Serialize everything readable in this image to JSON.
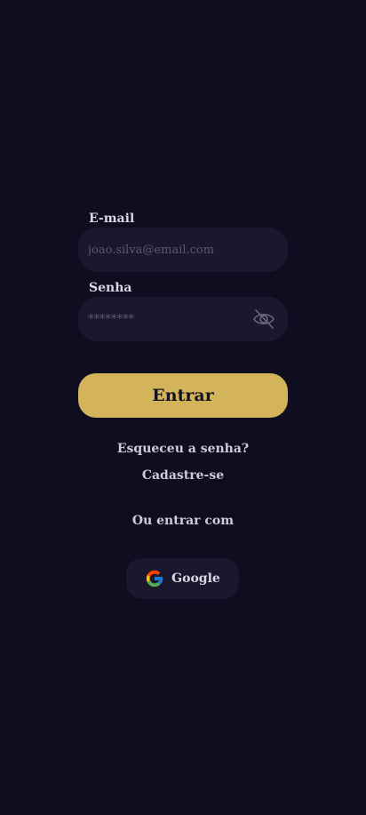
{
  "login": {
    "email_label": "E-mail",
    "email_placeholder": "joao.silva@email.com",
    "email_value": "",
    "password_label": "Senha",
    "password_placeholder": "********",
    "password_value": "",
    "password_toggle_icon": "eye-off-icon",
    "submit_label": "Entrar",
    "forgot_password_label": "Esqueceu a senha?",
    "signup_label": "Cadastre-se",
    "alt_login_label": "Ou entrar com",
    "google_label": "Google",
    "google_icon": "google-icon"
  },
  "colors": {
    "background": "#0f0d1f",
    "input_background": "#1b182e",
    "accent": "#d4b45a",
    "text": "#d9d6e6"
  }
}
